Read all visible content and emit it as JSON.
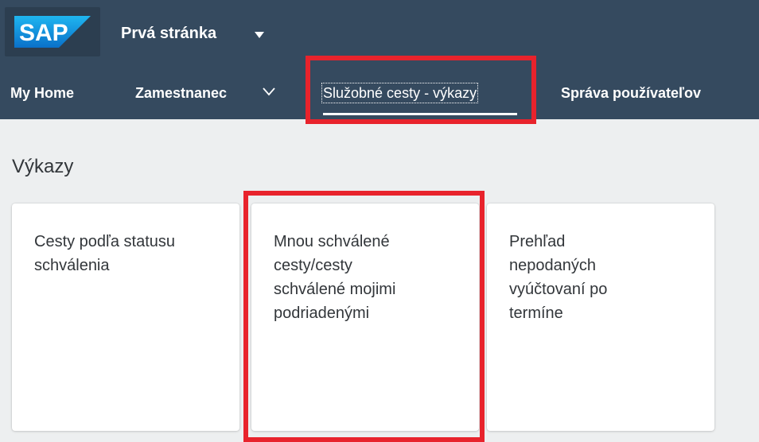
{
  "header": {
    "logo_text": "SAP",
    "app_title": "Prvá stránka",
    "app_title_icon": "caret-down-icon"
  },
  "nav": {
    "items": [
      {
        "label": "My Home"
      },
      {
        "label": "Zamestnanec",
        "icon": "chevron-down-icon"
      },
      {
        "label": "Služobné cesty - výkazy",
        "selected": true
      },
      {
        "label": "Správa používateľov"
      }
    ]
  },
  "section": {
    "title": "Výkazy"
  },
  "tiles": [
    {
      "title_lines": [
        "Cesty podľa statusu",
        "schválenia"
      ]
    },
    {
      "title_lines": [
        "Mnou schválené",
        "cesty/cesty",
        "schválené mojimi",
        "podriadenými"
      ]
    },
    {
      "title_lines": [
        "Prehľad",
        "nepodaných",
        "vyúčtovaní po",
        "termíne"
      ]
    }
  ],
  "colors": {
    "shell": "#354a5f",
    "background": "#edeff0",
    "highlight": "#e8232c",
    "tile_text": "#32363a"
  }
}
